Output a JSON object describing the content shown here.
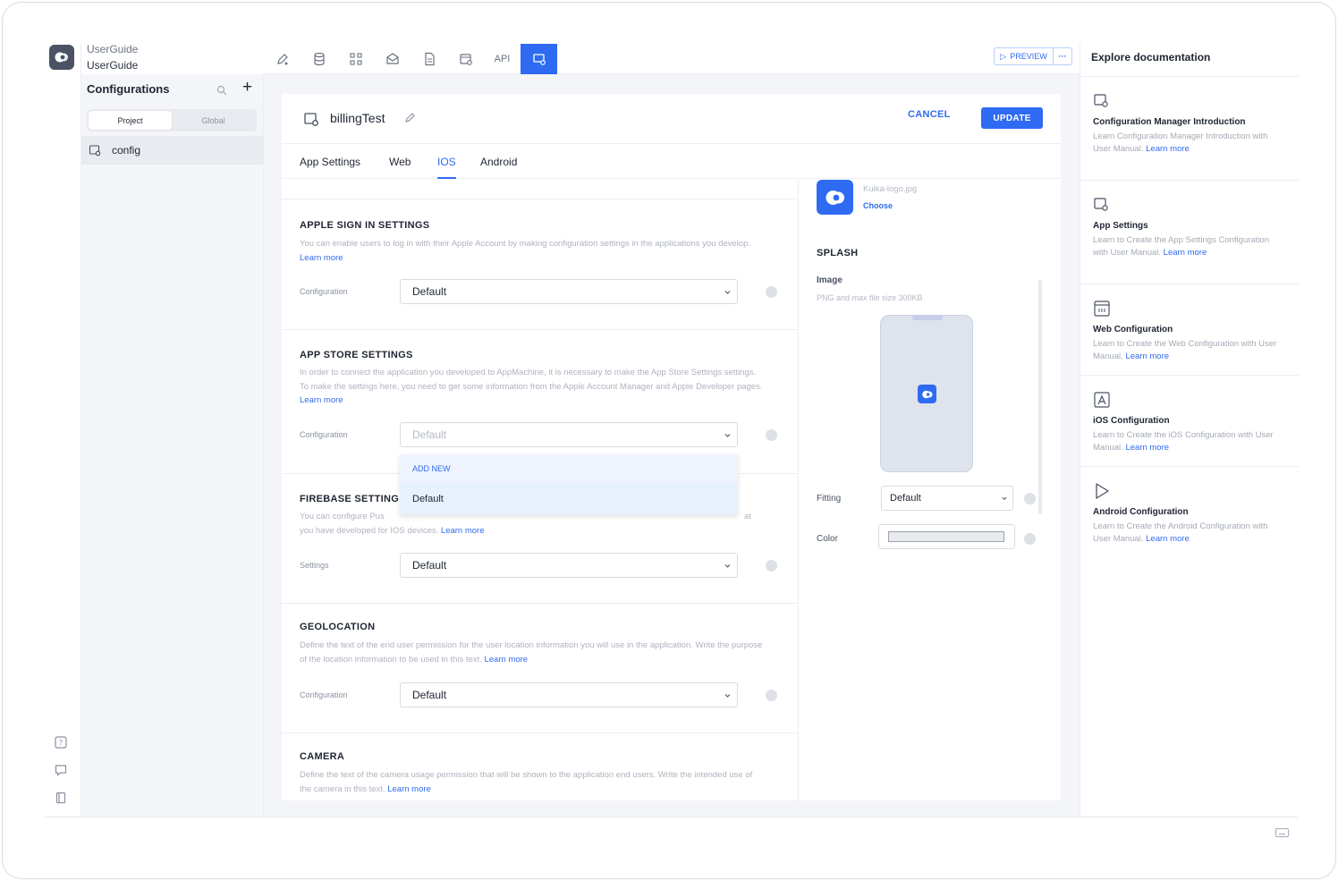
{
  "project": {
    "org": "UserGuide",
    "name": "UserGuide"
  },
  "config_panel": {
    "title": "Configurations",
    "segments": [
      "Project",
      "Global"
    ],
    "active_segment": "Project",
    "items": [
      "config"
    ]
  },
  "toolbar": {
    "api_label": "API",
    "preview_label": "PREVIEW",
    "more_label": "···"
  },
  "editor": {
    "title": "billingTest",
    "cancel_label": "CANCEL",
    "update_label": "UPDATE",
    "tabs": [
      "App Settings",
      "Web",
      "IOS",
      "Android"
    ],
    "active_tab": "IOS"
  },
  "sections": {
    "apple_sign_in": {
      "title": "APPLE SIGN IN SETTINGS",
      "desc": "You can enable users to log in with their Apple Account by making configuration settings in the applications you develop.",
      "learn_more": "Learn more",
      "field_label": "Configuration",
      "value": "Default"
    },
    "app_store": {
      "title": "APP STORE SETTINGS",
      "desc": "In order to connect the application you developed to AppMachine, it is necessary to make the App Store Settings settings. To make the settings here, you need to get some information from the Apple Account Manager and Apple Developer pages.",
      "learn_more": "Learn more",
      "field_label": "Configuration",
      "placeholder": "Default",
      "dropdown": {
        "add_new": "ADD NEW",
        "option": "Default"
      }
    },
    "firebase": {
      "title": "FIREBASE SETTING",
      "desc_start": "You can configure Pus",
      "desc_end": "at",
      "desc_line2": "you have developed for IOS devices.",
      "learn_more": "Learn more",
      "field_label": "Settings",
      "value": "Default"
    },
    "geolocation": {
      "title": "GEOLOCATION",
      "desc": "Define the text of the end user permission for the user location information you will use in the application. Write the purpose of the location information to be used in this text.",
      "learn_more": "Learn more",
      "field_label": "Configuration",
      "value": "Default"
    },
    "camera": {
      "title": "CAMERA",
      "desc": "Define the text of the camera usage permission that will be shown to the application end users. Write the intended use of the camera in this text.",
      "learn_more": "Learn more"
    }
  },
  "right_column": {
    "logo_file": "Kuika-logo.jpg",
    "choose_label": "Choose",
    "splash_title": "SPLASH",
    "image_label": "Image",
    "image_hint": "PNG and max file size 300KB",
    "fitting_label": "Fitting",
    "fitting_value": "Default",
    "color_label": "Color",
    "color_value": "#e8eaee"
  },
  "docs": {
    "title": "Explore documentation",
    "items": [
      {
        "title": "Configuration Manager Introduction",
        "desc": "Learn Configuration Manager Introduction with User Manual.",
        "link": "Learn more",
        "icon": "config-doc-icon"
      },
      {
        "title": "App Settings",
        "desc": "Learn to Create the App Settings Configuration with User Manual.",
        "link": "Learn more",
        "icon": "app-settings-icon"
      },
      {
        "title": "Web Configuration",
        "desc": "Learn to Create the Web Configuration with User Manual.",
        "link": "Learn more",
        "icon": "web-config-icon"
      },
      {
        "title": "iOS Configuration",
        "desc": "Learn to Create the iOS Configuration with User Manual.",
        "link": "Learn more",
        "icon": "ios-config-icon"
      },
      {
        "title": "Android Configuration",
        "desc": "Learn to Create the Android Configuration with User Manual.",
        "link": "Learn more",
        "icon": "android-config-icon"
      }
    ]
  },
  "colors": {
    "accent": "#2f6bf2",
    "panel_bg": "#f4f5f8",
    "border": "#eceef2"
  }
}
